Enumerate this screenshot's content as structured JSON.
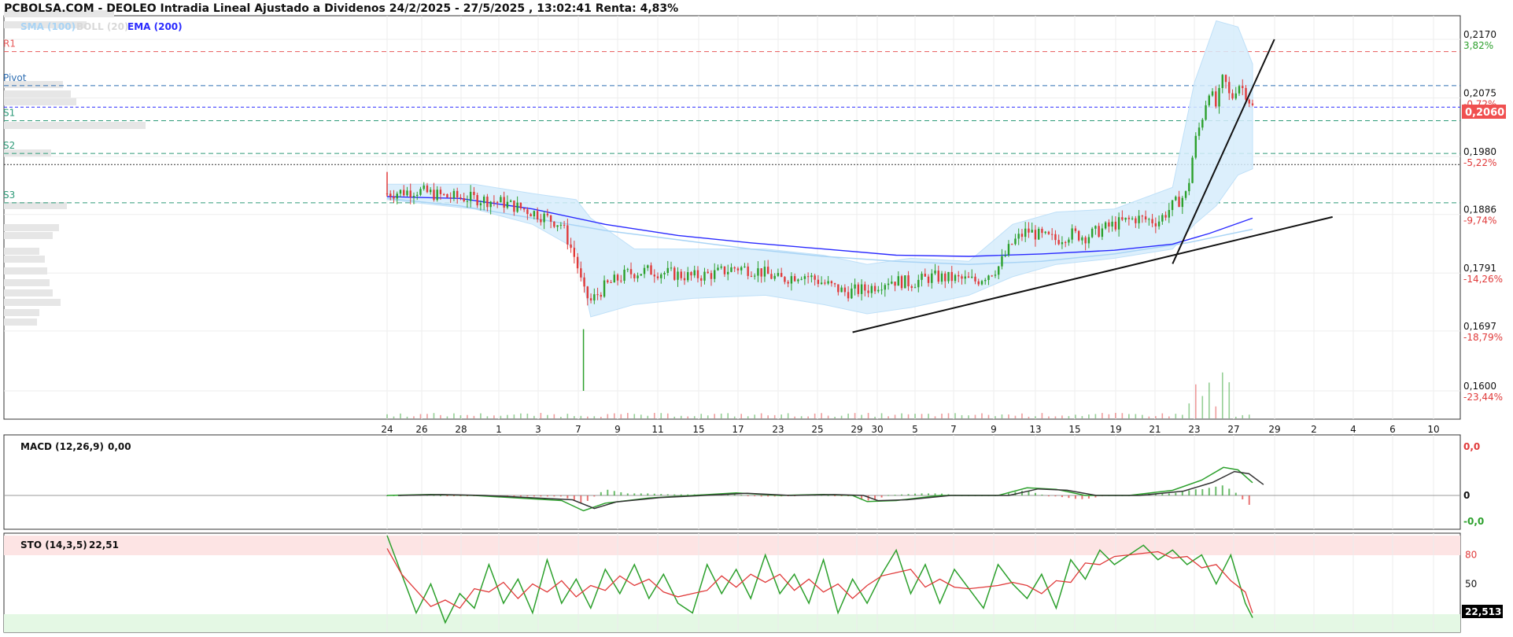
{
  "header": {
    "title": "PCBOLSA.COM - DEOLEO Intradia Lineal Ajustado a Dividenos 24/2/2025 - 27/5/2025 , 13:02:41 Renta: 4,83%"
  },
  "colors": {
    "sma": "#a9d4f5",
    "boll": "#d9d9d9",
    "ema": "#2a2aff",
    "up": "#2ca02c",
    "down": "#e03a3a",
    "resistance": "#e85a5a",
    "pivot": "#2f6fb3",
    "support": "#2e9a78",
    "last_price_bg": "#f05050",
    "band_fill": "#d6ecfb",
    "trendline": "#111111"
  },
  "chart_data": [
    {
      "type": "candlestick",
      "title": "PCBOLSA.COM - DEOLEO Intradia Lineal Ajustado a Dividenos 24/2/2025 - 27/5/2025 , 13:02:41 Renta: 4,83%",
      "legend": [
        {
          "name": "SMA (100)",
          "color": "#a9d4f5"
        },
        {
          "name": "BOLL (20)",
          "color": "#d9d9d9"
        },
        {
          "name": "EMA (200)",
          "color": "#2a2aff"
        }
      ],
      "x_tick_labels": [
        "24",
        "26",
        "28",
        "1",
        "3",
        "7",
        "9",
        "11",
        "15",
        "17",
        "23",
        "25",
        "29",
        "30",
        "5",
        "7",
        "9",
        "13",
        "15",
        "19",
        "21",
        "23",
        "27",
        "29",
        "2",
        "4",
        "6",
        "10"
      ],
      "y_ticks": [
        {
          "price": 0.217,
          "label": "0,2170",
          "pct": "3,82%"
        },
        {
          "price": 0.2075,
          "label": "0,2075",
          "pct": "-0,72%"
        },
        {
          "price": 0.198,
          "label": "0,1980",
          "pct": "-5,22%"
        },
        {
          "price": 0.1886,
          "label": "0,1886",
          "pct": "-9,74%"
        },
        {
          "price": 0.1791,
          "label": "0,1791",
          "pct": "-14,26%"
        },
        {
          "price": 0.1697,
          "label": "0,1697",
          "pct": "-18,79%"
        },
        {
          "price": 0.16,
          "label": "0,1600",
          "pct": "-23,44%"
        }
      ],
      "ylim": [
        0.16,
        0.217
      ],
      "last_price": {
        "value": 0.206,
        "label": "0,2060"
      },
      "pivots": [
        {
          "name": "R1",
          "price": 0.215
        },
        {
          "name": "Pivot",
          "price": 0.2095
        },
        {
          "name": "S1",
          "price": 0.2038
        },
        {
          "name": "S2",
          "price": 0.1985
        },
        {
          "name": "S3",
          "price": 0.1905
        }
      ],
      "reference_line": {
        "price": 0.1967
      },
      "price_path": [
        [
          0,
          0.192
        ],
        [
          4,
          0.1925
        ],
        [
          8,
          0.1915
        ],
        [
          12,
          0.1912
        ],
        [
          16,
          0.1905
        ],
        [
          20,
          0.189
        ],
        [
          24,
          0.187
        ],
        [
          26,
          0.181
        ],
        [
          27,
          0.176
        ],
        [
          28,
          0.1745
        ],
        [
          30,
          0.177
        ],
        [
          33,
          0.179
        ],
        [
          36,
          0.1795
        ],
        [
          39,
          0.179
        ],
        [
          42,
          0.1785
        ],
        [
          45,
          0.179
        ],
        [
          48,
          0.18
        ],
        [
          51,
          0.1795
        ],
        [
          54,
          0.178
        ],
        [
          57,
          0.179
        ],
        [
          60,
          0.1775
        ],
        [
          63,
          0.176
        ],
        [
          66,
          0.1765
        ],
        [
          69,
          0.178
        ],
        [
          72,
          0.1775
        ],
        [
          75,
          0.1785
        ],
        [
          78,
          0.1782
        ],
        [
          81,
          0.1778
        ],
        [
          84,
          0.18
        ],
        [
          86,
          0.184
        ],
        [
          88,
          0.186
        ],
        [
          90,
          0.185
        ],
        [
          92,
          0.1845
        ],
        [
          94,
          0.1855
        ],
        [
          96,
          0.185
        ],
        [
          98,
          0.186
        ],
        [
          100,
          0.187
        ],
        [
          103,
          0.188
        ],
        [
          106,
          0.1875
        ],
        [
          108,
          0.19
        ],
        [
          110,
          0.192
        ],
        [
          111,
          0.2
        ],
        [
          112,
          0.204
        ],
        [
          113,
          0.209
        ],
        [
          114,
          0.206
        ],
        [
          115,
          0.211
        ],
        [
          116,
          0.207
        ],
        [
          117,
          0.21
        ],
        [
          118,
          0.2085
        ],
        [
          119,
          0.206
        ]
      ],
      "sma100_path": [
        [
          0,
          0.1912
        ],
        [
          10,
          0.19
        ],
        [
          20,
          0.188
        ],
        [
          30,
          0.186
        ],
        [
          40,
          0.1845
        ],
        [
          50,
          0.183
        ],
        [
          60,
          0.1818
        ],
        [
          70,
          0.181
        ],
        [
          80,
          0.1805
        ],
        [
          90,
          0.181
        ],
        [
          100,
          0.1822
        ],
        [
          110,
          0.184
        ],
        [
          119,
          0.1862
        ]
      ],
      "ema200_path": [
        [
          0,
          0.1915
        ],
        [
          10,
          0.1912
        ],
        [
          20,
          0.1895
        ],
        [
          30,
          0.187
        ],
        [
          40,
          0.1852
        ],
        [
          50,
          0.184
        ],
        [
          60,
          0.183
        ],
        [
          70,
          0.182
        ],
        [
          80,
          0.1818
        ],
        [
          90,
          0.1822
        ],
        [
          100,
          0.1828
        ],
        [
          108,
          0.1838
        ],
        [
          113,
          0.1855
        ],
        [
          119,
          0.188
        ]
      ],
      "boll_upper": [
        [
          0,
          0.1935
        ],
        [
          12,
          0.1935
        ],
        [
          20,
          0.192
        ],
        [
          26,
          0.191
        ],
        [
          28,
          0.188
        ],
        [
          34,
          0.183
        ],
        [
          42,
          0.183
        ],
        [
          52,
          0.183
        ],
        [
          60,
          0.182
        ],
        [
          66,
          0.1805
        ],
        [
          72,
          0.1815
        ],
        [
          80,
          0.181
        ],
        [
          86,
          0.187
        ],
        [
          92,
          0.189
        ],
        [
          100,
          0.1895
        ],
        [
          108,
          0.193
        ],
        [
          111,
          0.21
        ],
        [
          114,
          0.22
        ],
        [
          117,
          0.219
        ],
        [
          119,
          0.213
        ]
      ],
      "boll_lower": [
        [
          0,
          0.191
        ],
        [
          12,
          0.1895
        ],
        [
          20,
          0.187
        ],
        [
          26,
          0.183
        ],
        [
          28,
          0.172
        ],
        [
          34,
          0.174
        ],
        [
          42,
          0.175
        ],
        [
          52,
          0.1755
        ],
        [
          60,
          0.174
        ],
        [
          66,
          0.1725
        ],
        [
          72,
          0.1735
        ],
        [
          80,
          0.1755
        ],
        [
          86,
          0.1785
        ],
        [
          92,
          0.1805
        ],
        [
          100,
          0.1815
        ],
        [
          108,
          0.183
        ],
        [
          111,
          0.187
        ],
        [
          114,
          0.19
        ],
        [
          117,
          0.195
        ],
        [
          119,
          0.196
        ]
      ],
      "trendlines": [
        {
          "from": [
            64,
            0.1695
          ],
          "to": [
            130,
            0.1882
          ]
        },
        {
          "from": [
            108,
            0.1806
          ],
          "to": [
            122,
            0.217
          ]
        }
      ]
    },
    {
      "type": "line",
      "name": "MACD (12,26,9)",
      "label": "MACD (12,26,9)",
      "current_value": "0,00",
      "y_tick_labels": [
        "0,0",
        "0",
        "-0,0"
      ],
      "macd_path": [
        [
          0,
          0.0
        ],
        [
          6,
          0.02
        ],
        [
          12,
          0.0
        ],
        [
          18,
          -0.05
        ],
        [
          24,
          -0.1
        ],
        [
          27,
          -0.3
        ],
        [
          30,
          -0.15
        ],
        [
          36,
          -0.05
        ],
        [
          42,
          0.0
        ],
        [
          48,
          0.05
        ],
        [
          54,
          0.0
        ],
        [
          60,
          0.02
        ],
        [
          64,
          0.0
        ],
        [
          66,
          -0.12
        ],
        [
          70,
          -0.1
        ],
        [
          76,
          0.0
        ],
        [
          84,
          0.0
        ],
        [
          88,
          0.15
        ],
        [
          92,
          0.12
        ],
        [
          96,
          0.0
        ],
        [
          102,
          0.0
        ],
        [
          108,
          0.1
        ],
        [
          112,
          0.3
        ],
        [
          115,
          0.55
        ],
        [
          117,
          0.5
        ],
        [
          119,
          0.25
        ]
      ]
    },
    {
      "type": "line",
      "name": "STO (14,3,5)",
      "label": "STO (14,3,5)",
      "current_value": "22,51",
      "current_badge": "22,513",
      "y_tick_labels": [
        "80",
        "50"
      ],
      "ylim": [
        0,
        100
      ],
      "k_path": [
        [
          0,
          100
        ],
        [
          2,
          60
        ],
        [
          4,
          20
        ],
        [
          6,
          50
        ],
        [
          8,
          10
        ],
        [
          10,
          40
        ],
        [
          12,
          25
        ],
        [
          14,
          70
        ],
        [
          16,
          30
        ],
        [
          18,
          55
        ],
        [
          20,
          20
        ],
        [
          22,
          75
        ],
        [
          24,
          30
        ],
        [
          26,
          55
        ],
        [
          28,
          25
        ],
        [
          30,
          65
        ],
        [
          32,
          40
        ],
        [
          34,
          70
        ],
        [
          36,
          35
        ],
        [
          38,
          60
        ],
        [
          40,
          30
        ],
        [
          42,
          20
        ],
        [
          44,
          70
        ],
        [
          46,
          40
        ],
        [
          48,
          65
        ],
        [
          50,
          35
        ],
        [
          52,
          80
        ],
        [
          54,
          40
        ],
        [
          56,
          60
        ],
        [
          58,
          30
        ],
        [
          60,
          75
        ],
        [
          62,
          20
        ],
        [
          64,
          55
        ],
        [
          66,
          30
        ],
        [
          68,
          60
        ],
        [
          70,
          85
        ],
        [
          72,
          40
        ],
        [
          74,
          70
        ],
        [
          76,
          30
        ],
        [
          78,
          65
        ],
        [
          80,
          45
        ],
        [
          82,
          25
        ],
        [
          84,
          70
        ],
        [
          86,
          50
        ],
        [
          88,
          35
        ],
        [
          90,
          60
        ],
        [
          92,
          25
        ],
        [
          94,
          75
        ],
        [
          96,
          55
        ],
        [
          98,
          85
        ],
        [
          100,
          70
        ],
        [
          102,
          80
        ],
        [
          104,
          90
        ],
        [
          106,
          75
        ],
        [
          108,
          85
        ],
        [
          110,
          70
        ],
        [
          112,
          80
        ],
        [
          114,
          50
        ],
        [
          116,
          80
        ],
        [
          118,
          30
        ],
        [
          119,
          15
        ]
      ]
    }
  ]
}
